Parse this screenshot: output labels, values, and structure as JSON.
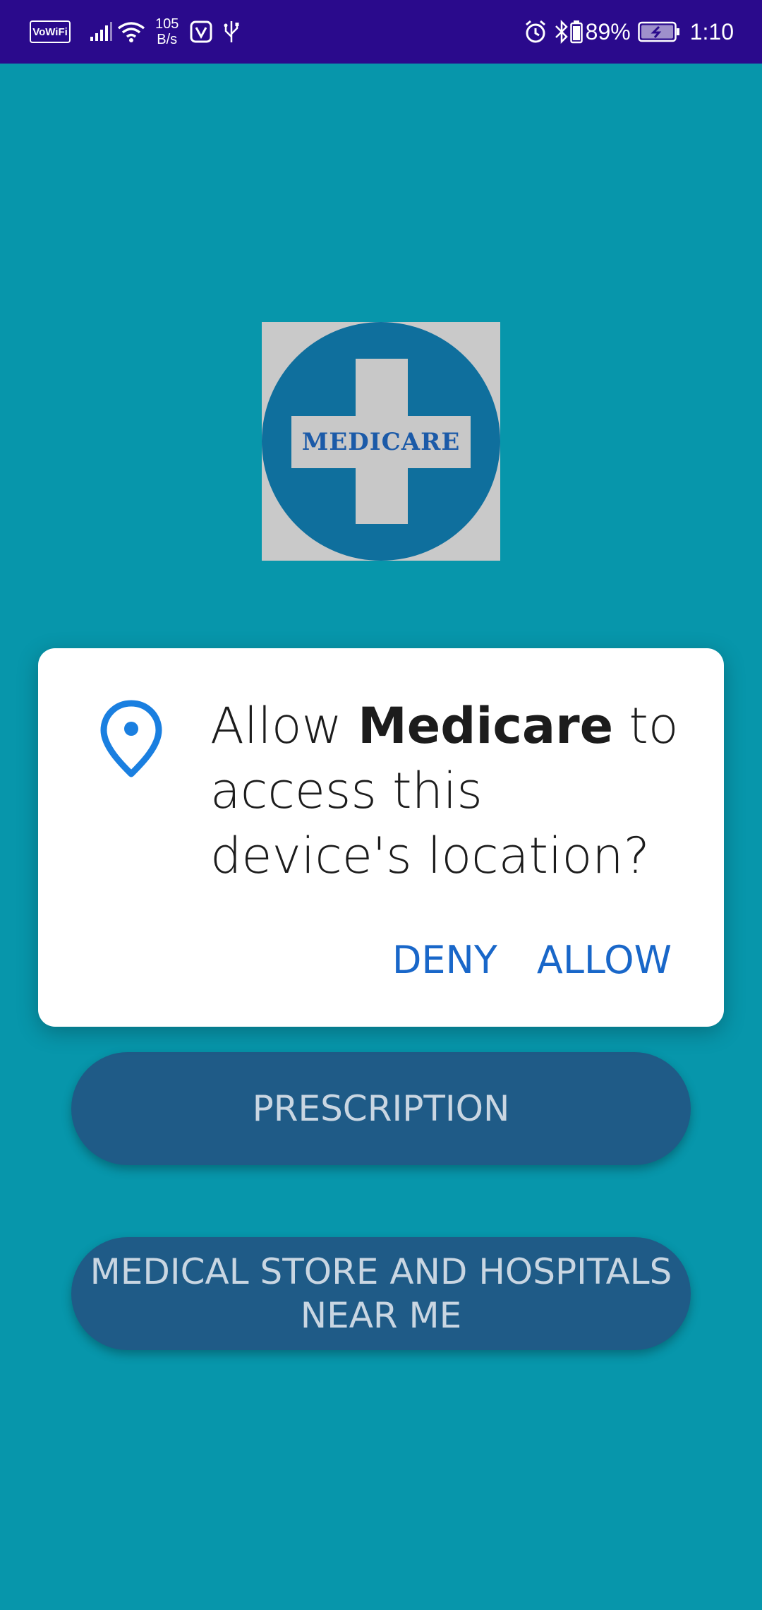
{
  "status_bar": {
    "vowifi": "VoWiFi",
    "speed_value": "105",
    "speed_unit": "B/s",
    "battery_percent": "89%",
    "time": "1:10",
    "icons": [
      "signal-icon",
      "wifi-icon",
      "app-notification-icon",
      "usb-icon",
      "alarm-icon",
      "bluetooth-icon",
      "battery-icon",
      "charging-icon"
    ]
  },
  "logo": {
    "text": "MEDICARE"
  },
  "dialog": {
    "message_prefix": "Allow ",
    "app_name": "Medicare",
    "message_suffix": " to access this device's location?",
    "deny_label": "DENY",
    "allow_label": "ALLOW",
    "icon": "location-pin-icon"
  },
  "buttons": {
    "prescription": "PRESCRIPTION",
    "stores": "MEDICAL STORE AND HOSPITALS NEAR ME"
  },
  "colors": {
    "background": "#0796ab",
    "status_bar": "#2a0a8c",
    "button": "#1f5b87",
    "dialog_action": "#1967c9"
  }
}
